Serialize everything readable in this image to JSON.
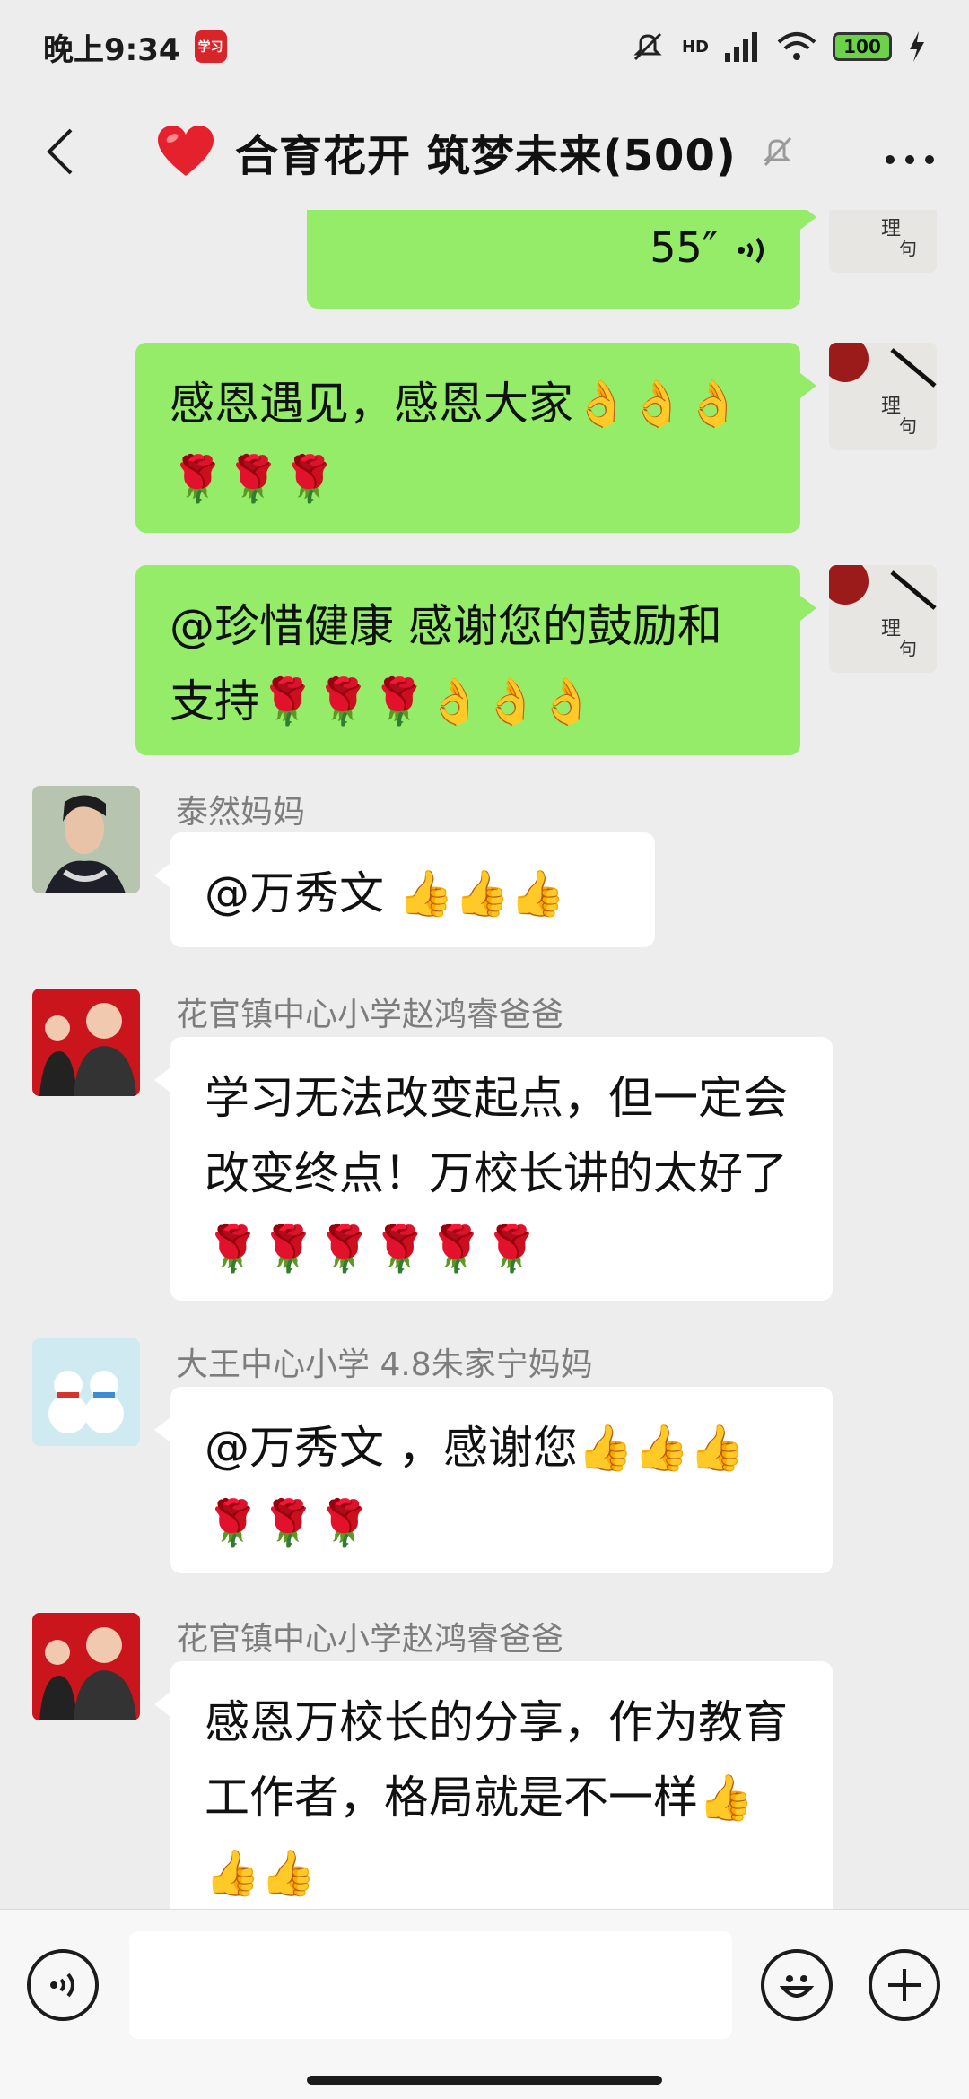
{
  "status_bar": {
    "time": "晚上9:34",
    "app_badge": "学习",
    "network": "HD",
    "battery": "100"
  },
  "header": {
    "title": "合育花开 筑梦未来(500)",
    "back_icon": "chevron-left-icon",
    "heart_icon": "heart-icon",
    "mute_icon": "bell-muted-icon",
    "more_icon": "more-icon"
  },
  "messages": [
    {
      "side": "right",
      "type": "voice",
      "duration": "55″"
    },
    {
      "side": "right",
      "type": "text",
      "text": "感恩遇见，感恩大家👌👌👌🌹🌹🌹"
    },
    {
      "side": "right",
      "type": "text",
      "text": "@珍惜健康  感谢您的鼓励和支持🌹🌹🌹👌👌👌"
    },
    {
      "side": "left",
      "sender": "泰然妈妈",
      "text": "@万秀文 👍👍👍"
    },
    {
      "side": "left",
      "sender": "花官镇中心小学赵鸿睿爸爸",
      "text": "学习无法改变起点，但一定会改变终点！万校长讲的太好了🌹🌹🌹🌹🌹🌹"
    },
    {
      "side": "left",
      "sender": "大王中心小学 4.8朱家宁妈妈",
      "text": "@万秀文 ，感谢您👍👍👍🌹🌹🌹"
    },
    {
      "side": "left",
      "sender": "花官镇中心小学赵鸿睿爸爸",
      "text": "感恩万校长的分享，作为教育工作者，格局就是不一样👍👍👍"
    }
  ],
  "input_bar": {
    "placeholder": "",
    "voice_icon": "voice-icon",
    "emoji_icon": "smile-icon",
    "plus_icon": "plus-icon"
  },
  "colors": {
    "my_bubble": "#95ec69",
    "other_bubble": "#ffffff",
    "background": "#ededed",
    "sender_name": "#7d7d7d"
  }
}
